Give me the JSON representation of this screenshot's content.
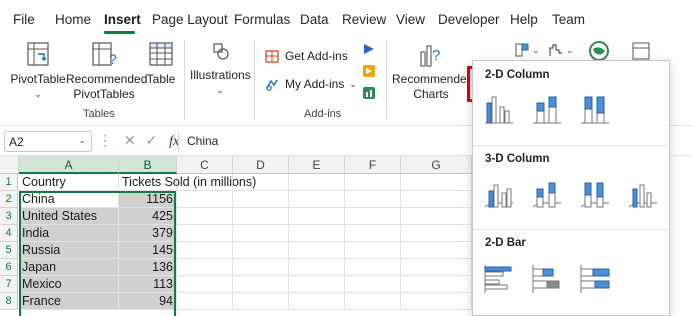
{
  "menu": {
    "items": [
      "File",
      "Home",
      "Insert",
      "Page Layout",
      "Formulas",
      "Data",
      "Review",
      "View",
      "Developer",
      "Help",
      "Team"
    ],
    "active": "Insert"
  },
  "ribbon": {
    "tables": {
      "pivot_label": "PivotTable",
      "recommended_label_1": "Recommended",
      "recommended_label_2": "PivotTables",
      "table_label": "Table",
      "group_label": "Tables"
    },
    "illustrations": {
      "label": "Illustrations"
    },
    "addins": {
      "get_label": "Get Add-ins",
      "my_label": "My Add-ins",
      "group_label": "Add-ins"
    },
    "charts": {
      "recommended_label_1": "Recommended",
      "recommended_label_2": "Charts"
    }
  },
  "formula_bar": {
    "name_box": "A2",
    "fx": "fx",
    "value": "China"
  },
  "grid": {
    "columns": [
      "A",
      "B",
      "C",
      "D",
      "E",
      "F",
      "G"
    ],
    "header_row": {
      "a": "Country",
      "b": "Tickets Sold (in millions)"
    },
    "rows": [
      {
        "country": "China",
        "tickets": "1156"
      },
      {
        "country": "United States",
        "tickets": "425"
      },
      {
        "country": "India",
        "tickets": "379"
      },
      {
        "country": "Russia",
        "tickets": "145"
      },
      {
        "country": "Japan",
        "tickets": "136"
      },
      {
        "country": "Mexico",
        "tickets": "113"
      },
      {
        "country": "France",
        "tickets": "94"
      }
    ]
  },
  "chart_dropdown": {
    "section_2d_column": "2-D Column",
    "section_3d_column": "3-D Column",
    "section_2d_bar": "2-D Bar"
  },
  "colors": {
    "accent_green": "#107c41",
    "highlight_red": "#e00000",
    "chart_blue": "#4a90d9",
    "chart_gray": "#8c8c8c"
  }
}
